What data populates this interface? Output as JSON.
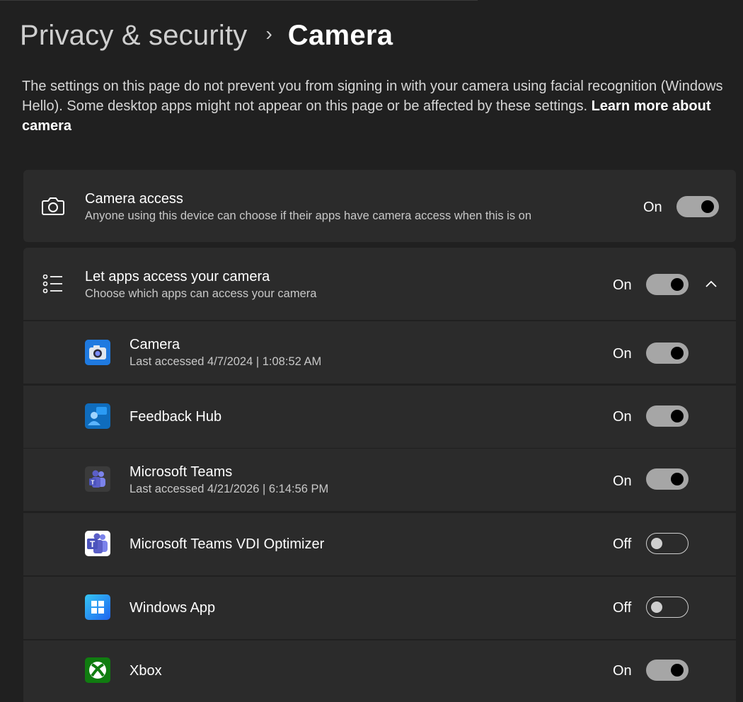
{
  "breadcrumb": {
    "parent": "Privacy & security",
    "separator": "›",
    "current": "Camera"
  },
  "intro": {
    "text": "The settings on this page do not prevent you from signing in with your camera using facial recognition (Windows Hello). Some desktop apps might not appear on this page or be affected by these settings. ",
    "link": "Learn more about camera"
  },
  "camera_access": {
    "title": "Camera access",
    "subtitle": "Anyone using this device can choose if their apps have camera access when this is on",
    "state": "On",
    "icon": "camera-outline-icon"
  },
  "apps_access": {
    "title": "Let apps access your camera",
    "subtitle": "Choose which apps can access your camera",
    "state": "On",
    "icon": "list-icon",
    "expand_icon": "chevron-up-icon"
  },
  "apps": [
    {
      "name": "Camera",
      "last_accessed": "Last accessed 4/7/2024  |  1:08:52 AM",
      "state": "On",
      "icon": "camera-app-icon"
    },
    {
      "name": "Feedback Hub",
      "last_accessed": "",
      "state": "On",
      "icon": "feedback-hub-icon"
    },
    {
      "name": "Microsoft Teams",
      "last_accessed": "Last accessed 4/21/2026  |  6:14:56 PM",
      "state": "On",
      "icon": "teams-icon"
    },
    {
      "name": "Microsoft Teams VDI Optimizer",
      "last_accessed": "",
      "state": "Off",
      "icon": "teams-vdi-icon"
    },
    {
      "name": "Windows App",
      "last_accessed": "",
      "state": "Off",
      "icon": "windows-app-icon"
    },
    {
      "name": "Xbox",
      "last_accessed": "",
      "state": "On",
      "icon": "xbox-icon"
    }
  ],
  "colors": {
    "background": "#202020",
    "card": "#2b2b2b",
    "toggle_on": "#a6a6a6",
    "teams_purple": "#5b5fc7",
    "xbox_green": "#107c10",
    "windows_blue": "#1e90ff"
  }
}
